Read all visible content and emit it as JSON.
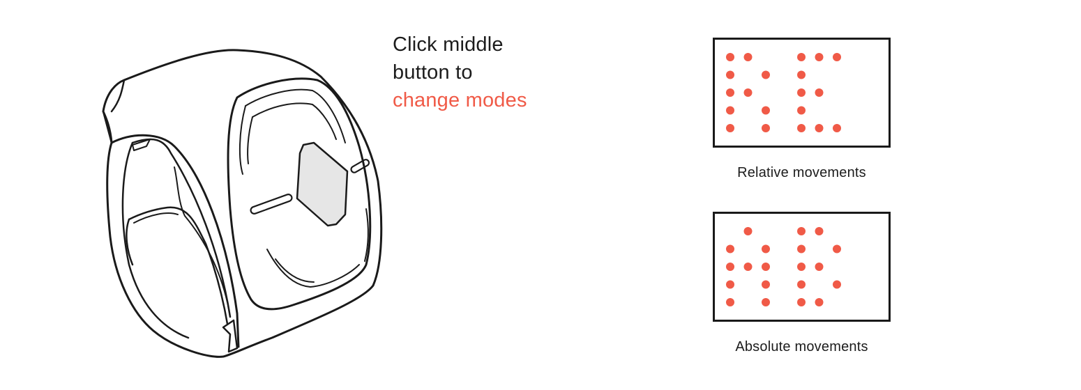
{
  "headline": {
    "line1": "Click middle",
    "line2": "button to",
    "line3": "change modes"
  },
  "modes": [
    {
      "caption": "Relative movements",
      "dots": [
        [
          1,
          1
        ],
        [
          2,
          1
        ],
        [
          5,
          1
        ],
        [
          6,
          1
        ],
        [
          7,
          1
        ],
        [
          1,
          2
        ],
        [
          3,
          2
        ],
        [
          5,
          2
        ],
        [
          1,
          3
        ],
        [
          2,
          3
        ],
        [
          5,
          3
        ],
        [
          6,
          3
        ],
        [
          1,
          4
        ],
        [
          3,
          4
        ],
        [
          5,
          4
        ],
        [
          1,
          5
        ],
        [
          3,
          5
        ],
        [
          5,
          5
        ],
        [
          6,
          5
        ],
        [
          7,
          5
        ]
      ]
    },
    {
      "caption": "Absolute movements",
      "dots": [
        [
          2,
          1
        ],
        [
          5,
          1
        ],
        [
          6,
          1
        ],
        [
          1,
          2
        ],
        [
          3,
          2
        ],
        [
          5,
          2
        ],
        [
          7,
          2
        ],
        [
          1,
          3
        ],
        [
          2,
          3
        ],
        [
          3,
          3
        ],
        [
          5,
          3
        ],
        [
          6,
          3
        ],
        [
          1,
          4
        ],
        [
          3,
          4
        ],
        [
          5,
          4
        ],
        [
          7,
          4
        ],
        [
          1,
          5
        ],
        [
          3,
          5
        ],
        [
          5,
          5
        ],
        [
          6,
          5
        ]
      ]
    }
  ],
  "colors": {
    "accent": "#f05a47",
    "text": "#1c1c1c",
    "outline": "#1a1a1a",
    "button_fill": "#e6e6e6"
  },
  "icons": {
    "device": "wearable-ring-controller-icon"
  }
}
